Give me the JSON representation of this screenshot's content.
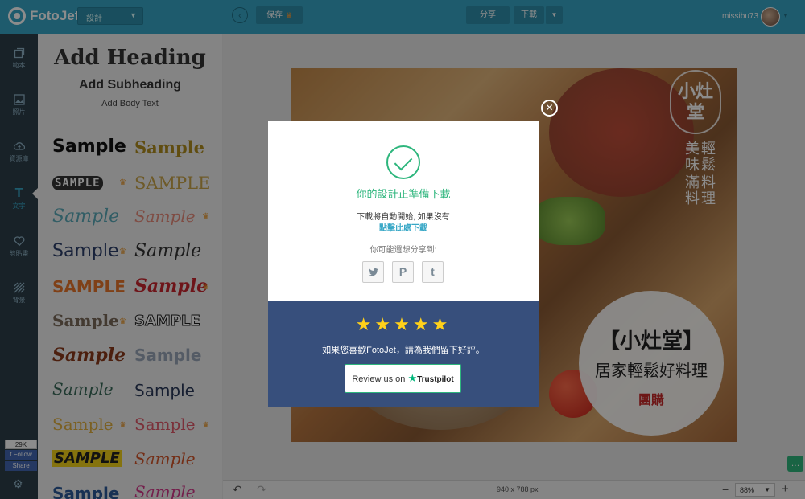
{
  "app": {
    "logo_text": "FotoJet"
  },
  "toolbar": {
    "mode_value": "設計",
    "save_label": "保存",
    "share_label": "分享",
    "download_label": "下載",
    "username": "missibu73"
  },
  "sidebar": {
    "items": [
      {
        "label": "範本",
        "icon": "template-icon"
      },
      {
        "label": "照片",
        "icon": "photo-icon"
      },
      {
        "label": "資源庫",
        "icon": "cloud-upload-icon"
      },
      {
        "label": "文字",
        "icon": "text-icon",
        "active": true
      },
      {
        "label": "剪貼畫",
        "icon": "heart-icon"
      },
      {
        "label": "背景",
        "icon": "background-icon"
      }
    ],
    "facebook": {
      "count": "29K",
      "follow_label": "Follow",
      "share_label": "Share"
    }
  },
  "text_panel": {
    "heading": "Add Heading",
    "subheading": "Add Subheading",
    "body": "Add Body Text",
    "samples": [
      {
        "text": "Sample"
      },
      {
        "text": "Sample"
      },
      {
        "text": "SAMPLE"
      },
      {
        "text": "SAMPLE"
      },
      {
        "text": "Sample"
      },
      {
        "text": "Sample"
      },
      {
        "text": "Sample"
      },
      {
        "text": "Sample"
      },
      {
        "text": "SAMPLE"
      },
      {
        "text": "Sample"
      },
      {
        "text": "Sample"
      },
      {
        "text": "SAMPLE"
      },
      {
        "text": "Sample"
      },
      {
        "text": "Sample"
      },
      {
        "text": "Sample"
      },
      {
        "text": "Sample"
      },
      {
        "text": "Sample"
      },
      {
        "text": "Sample"
      },
      {
        "text": "SAMPLE"
      },
      {
        "text": "Sample"
      },
      {
        "text": "Sample"
      },
      {
        "text": "Sample"
      }
    ]
  },
  "design": {
    "logo_text": "小灶堂",
    "vertical_text_1": "美味",
    "vertical_text_2": "輕鬆",
    "vertical_text_3": "滿料",
    "vertical_text_4": "料理",
    "title": "【小灶堂】",
    "subtitle": "居家輕鬆好料理",
    "group_buy": "團購"
  },
  "modal": {
    "title": "你的設計正準備下載",
    "line1": "下載將自動開始, 如果沒有",
    "link": "點擊此處下載",
    "share_prompt": "你可能還想分享到:",
    "social": [
      {
        "glyph": "🐦",
        "icon": "twitter-icon"
      },
      {
        "glyph": "P",
        "icon": "pinterest-icon"
      },
      {
        "glyph": "t",
        "icon": "tumblr-icon"
      }
    ],
    "stars": "★★★★★",
    "cta": "如果您喜歡FotoJet，請為我們留下好評。",
    "review_label": "Review us on",
    "trustpilot": "Trustpilot",
    "colors": {
      "accent_green": "#2eb67d",
      "banner_blue": "#374f7c",
      "star_yellow": "#ffd11a"
    }
  },
  "bottombar": {
    "canvas_size": "940 x 788 px",
    "zoom_value": "88%"
  }
}
